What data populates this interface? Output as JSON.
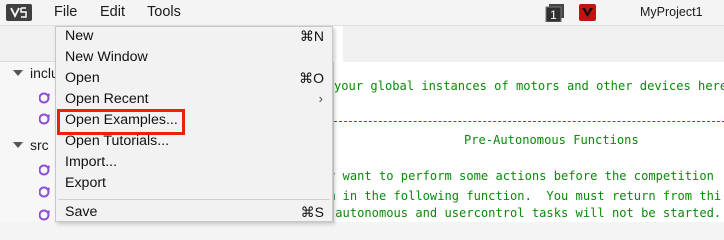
{
  "menubar": {
    "file": "File",
    "edit": "Edit",
    "tools": "Tools",
    "badge_number": "1",
    "project_name": "MyProject1"
  },
  "tree": {
    "include_folder": "inclu",
    "src_folder": "src"
  },
  "editor": {
    "lines": [
      "your global instances of motors and other devices here",
      "Pre-Autonomous Functions",
      "y want to perform some actions before the competition",
      "m in the following function.  You must return from thi",
      " autonomous and usercontrol tasks will not be started."
    ]
  },
  "file_menu": {
    "items": [
      {
        "label": "New",
        "shortcut": "⌘N"
      },
      {
        "label": "New Window",
        "shortcut": ""
      },
      {
        "label": "Open",
        "shortcut": "⌘O"
      },
      {
        "label": "Open Recent",
        "shortcut": "›"
      },
      {
        "label": "Open Examples...",
        "shortcut": ""
      },
      {
        "label": "Open Tutorials...",
        "shortcut": ""
      },
      {
        "label": "Import...",
        "shortcut": ""
      },
      {
        "label": "Export",
        "shortcut": ""
      },
      {
        "label": "Save",
        "shortcut": "⌘S"
      }
    ],
    "highlighted_item": "Open Examples..."
  },
  "colors": {
    "highlight_border": "#e8220f",
    "code_green": "#0a8a0a",
    "vex_red": "#c41212"
  },
  "icons": [
    "vexcode-logo-icon",
    "one-badge-icon",
    "vex-logo-icon",
    "cpp-file-icon",
    "caret-down-icon",
    "chevron-right-icon"
  ]
}
